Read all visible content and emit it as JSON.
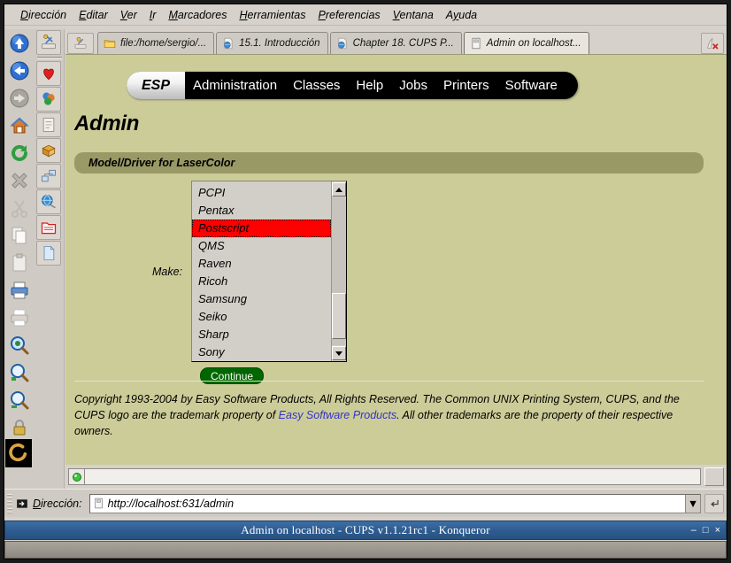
{
  "window": {
    "title": "Admin on localhost - CUPS v1.1.21rc1 - Konqueror",
    "minimize": "–",
    "maximize": "□",
    "close": "×"
  },
  "menubar": {
    "items": [
      {
        "label": "Dirección",
        "accel": "D"
      },
      {
        "label": "Editar",
        "accel": "E"
      },
      {
        "label": "Ver",
        "accel": "V"
      },
      {
        "label": "Ir",
        "accel": "I"
      },
      {
        "label": "Marcadores",
        "accel": "M"
      },
      {
        "label": "Herramientas",
        "accel": "H"
      },
      {
        "label": "Preferencias",
        "accel": "P"
      },
      {
        "label": "Ventana",
        "accel": "V"
      },
      {
        "label": "Ayuda",
        "accel": "y"
      }
    ]
  },
  "tabs": {
    "items": [
      {
        "label": "file:/home/sergio/...",
        "icon": "folder-icon",
        "active": false
      },
      {
        "label": "15.1. Introducción",
        "icon": "html-page-icon",
        "active": false
      },
      {
        "label": "Chapter 18. CUPS P...",
        "icon": "html-page-icon",
        "active": false
      },
      {
        "label": "Admin on localhost...",
        "icon": "document-icon",
        "active": true
      }
    ],
    "new_tab_tooltip": "Nueva pestaña",
    "close_tab_tooltip": "Cerrar pestaña"
  },
  "sidebar": {
    "icons_left": [
      "up-arrow-icon",
      "back-arrow-icon",
      "forward-arrow-icon",
      "home-icon",
      "reload-icon",
      "stop-icon",
      "cut-icon",
      "copy-icon",
      "paste-icon",
      "print-icon",
      "print-preview-icon",
      "find-icon",
      "zoom-in-icon",
      "zoom-out-icon",
      "lock-icon",
      "download-icon"
    ],
    "icons_right": [
      "konqueror-icon",
      "bookmark-heart-icon",
      "colors-icon",
      "scroll-icon",
      "package-icon",
      "network-icon",
      "globe-icon",
      "folder-red-icon",
      "new-document-icon"
    ],
    "logo": "konqueror-animated-logo"
  },
  "page": {
    "nav": {
      "brand": "ESP",
      "links": [
        "Administration",
        "Classes",
        "Help",
        "Jobs",
        "Printers",
        "Software"
      ]
    },
    "heading": "Admin",
    "section_title": "Model/Driver for LaserColor",
    "form": {
      "make_label": "Make:",
      "options": [
        "PCPI",
        "Pentax",
        "Postscript",
        "QMS",
        "Raven",
        "Ricoh",
        "Samsung",
        "Seiko",
        "Sharp",
        "Sony"
      ],
      "selected": "Postscript",
      "continue_label": "Continue"
    },
    "footer": {
      "line1": "Copyright 1993-2004 by Easy Software Products, All Rights Reserved. The Common UNIX Printing System, CUPS, and the CUPS logo are the trademark property of ",
      "link": "Easy Software Products",
      "line2": ". All other trademarks are the property of their respective owners."
    }
  },
  "statusbar": {
    "text": "",
    "led": "ready-green"
  },
  "addressbar": {
    "label": "Dirección:",
    "accel": "D",
    "url": "http://localhost:631/admin",
    "dropdown": "▼",
    "go": "↵"
  },
  "colors": {
    "page_background": "#cccc99",
    "section_bar": "#999966",
    "nav_background": "#000000",
    "selection": "#ff0000",
    "link": "#3333cc",
    "button_green": "#006600",
    "titlebar": "#2f5d92"
  }
}
